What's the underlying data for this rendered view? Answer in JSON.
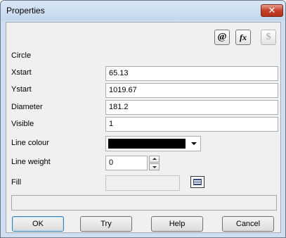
{
  "window": {
    "title": "Properties",
    "close_glyph": "✕"
  },
  "toolbar": {
    "at_glyph": "@",
    "fx_glyph": "fx",
    "dollar_glyph": "$",
    "icons": [
      "at-icon",
      "fx-icon",
      "dollar-icon"
    ]
  },
  "section": {
    "title": "Circle"
  },
  "fields": {
    "xstart": {
      "label": "Xstart",
      "value": "65.13"
    },
    "ystart": {
      "label": "Ystart",
      "value": "1019.67"
    },
    "diameter": {
      "label": "Diameter",
      "value": "181.2"
    },
    "visible": {
      "label": "Visible",
      "value": "1"
    },
    "line_colour": {
      "label": "Line colour",
      "value_color": "#000000"
    },
    "line_weight": {
      "label": "Line weight",
      "value": "0"
    },
    "fill": {
      "label": "Fill",
      "value": ""
    }
  },
  "buttons": {
    "ok": "OK",
    "try": "Try",
    "help": "Help",
    "cancel": "Cancel"
  },
  "colors": {
    "titlebar": "#c9dbf0",
    "close_button": "#c7402b",
    "dialog_background": "#f0f0f0"
  }
}
